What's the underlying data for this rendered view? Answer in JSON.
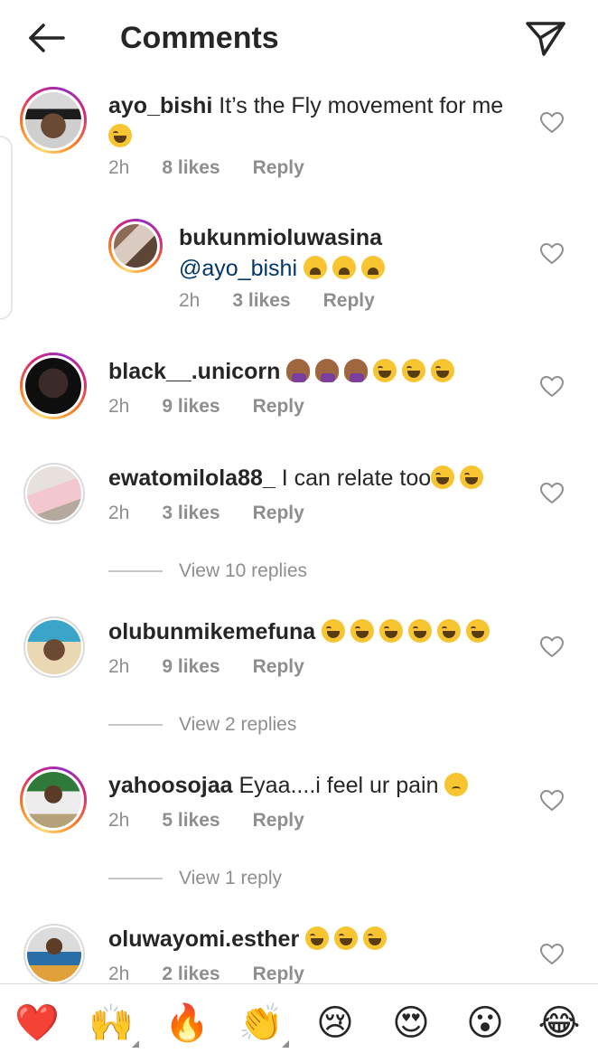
{
  "header": {
    "title": "Comments"
  },
  "comments": [
    {
      "username": "ayo_bishi",
      "text": " It’s the Fly movement for me",
      "time": "2h",
      "likes": "8 likes",
      "reply": "Reply"
    },
    {
      "username": "bukunmioluwasina",
      "mention": "@ayo_bishi",
      "time": "2h",
      "likes": "3 likes",
      "reply": "Reply"
    },
    {
      "username": "black__.unicorn",
      "time": "2h",
      "likes": "9 likes",
      "reply": "Reply"
    },
    {
      "username": "ewatomilola88_",
      "text": " I can relate too",
      "time": "2h",
      "likes": "3 likes",
      "reply": "Reply",
      "view_replies": "View 10 replies"
    },
    {
      "username": "olubunmikemefuna",
      "time": "2h",
      "likes": "9 likes",
      "reply": "Reply",
      "view_replies": "View 2 replies"
    },
    {
      "username": "yahoosojaa",
      "text": " Eyaa....i feel ur pain",
      "time": "2h",
      "likes": "5 likes",
      "reply": "Reply",
      "view_replies": "View 1 reply"
    },
    {
      "username": "oluwayomi.esther",
      "time": "2h",
      "likes": "2 likes",
      "reply": "Reply"
    }
  ],
  "reactions": [
    {
      "icon": "red-heart-emoji",
      "glyph": "❤️"
    },
    {
      "icon": "raising-hands-emoji",
      "glyph": "🙌"
    },
    {
      "icon": "fire-emoji",
      "glyph": "🔥"
    },
    {
      "icon": "clapping-hands-emoji",
      "glyph": "👏"
    },
    {
      "icon": "crying-face-emoji",
      "glyph": "😢"
    },
    {
      "icon": "heart-eyes-emoji",
      "glyph": "😍"
    },
    {
      "icon": "astonished-face-emoji",
      "glyph": "😮"
    },
    {
      "icon": "tears-of-joy-emoji",
      "glyph": "😂"
    }
  ],
  "colors": {
    "mention": "#00376b",
    "meta": "#8e8e8e",
    "text": "#262626"
  }
}
